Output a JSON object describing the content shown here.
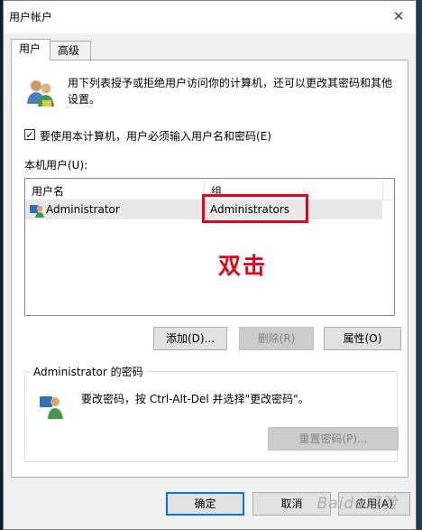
{
  "window": {
    "title": "用户帐户",
    "close_glyph": "✕"
  },
  "tabs": [
    {
      "label": "用户",
      "active": true
    },
    {
      "label": "高级",
      "active": false
    }
  ],
  "intro_text": "用下列表授予或拒绝用户访问你的计算机，还可以更改其密码和其他设置。",
  "require_login": {
    "checked": true,
    "check_glyph": "✓",
    "label": "要使用本计算机，用户必须输入用户名和密码(E)"
  },
  "local_users": {
    "label": "本机用户(U):",
    "columns": {
      "name": "用户名",
      "group": "组"
    },
    "rows": [
      {
        "name": "Administrator",
        "group": "Administrators"
      }
    ]
  },
  "annotation": {
    "text": "双击",
    "color": "#e2001a"
  },
  "user_buttons": {
    "add": "添加(D)...",
    "remove": "删除(R)",
    "properties": "属性(O)"
  },
  "password_group": {
    "title": "Administrator 的密码",
    "text": "要改密码，按 Ctrl-Alt-Del 并选择\"更改密码\"。",
    "reset_button": "重置密码(P)..."
  },
  "footer_buttons": {
    "ok": "确定",
    "cancel": "取消",
    "apply": "应用(A)"
  },
  "watermark": "Baidu经验",
  "icons": {
    "users": "users-icon",
    "user_row": "user-icon",
    "password_user": "user-key-icon"
  },
  "colors": {
    "accent": "#0078d7",
    "annotation_red": "#e2001a"
  }
}
